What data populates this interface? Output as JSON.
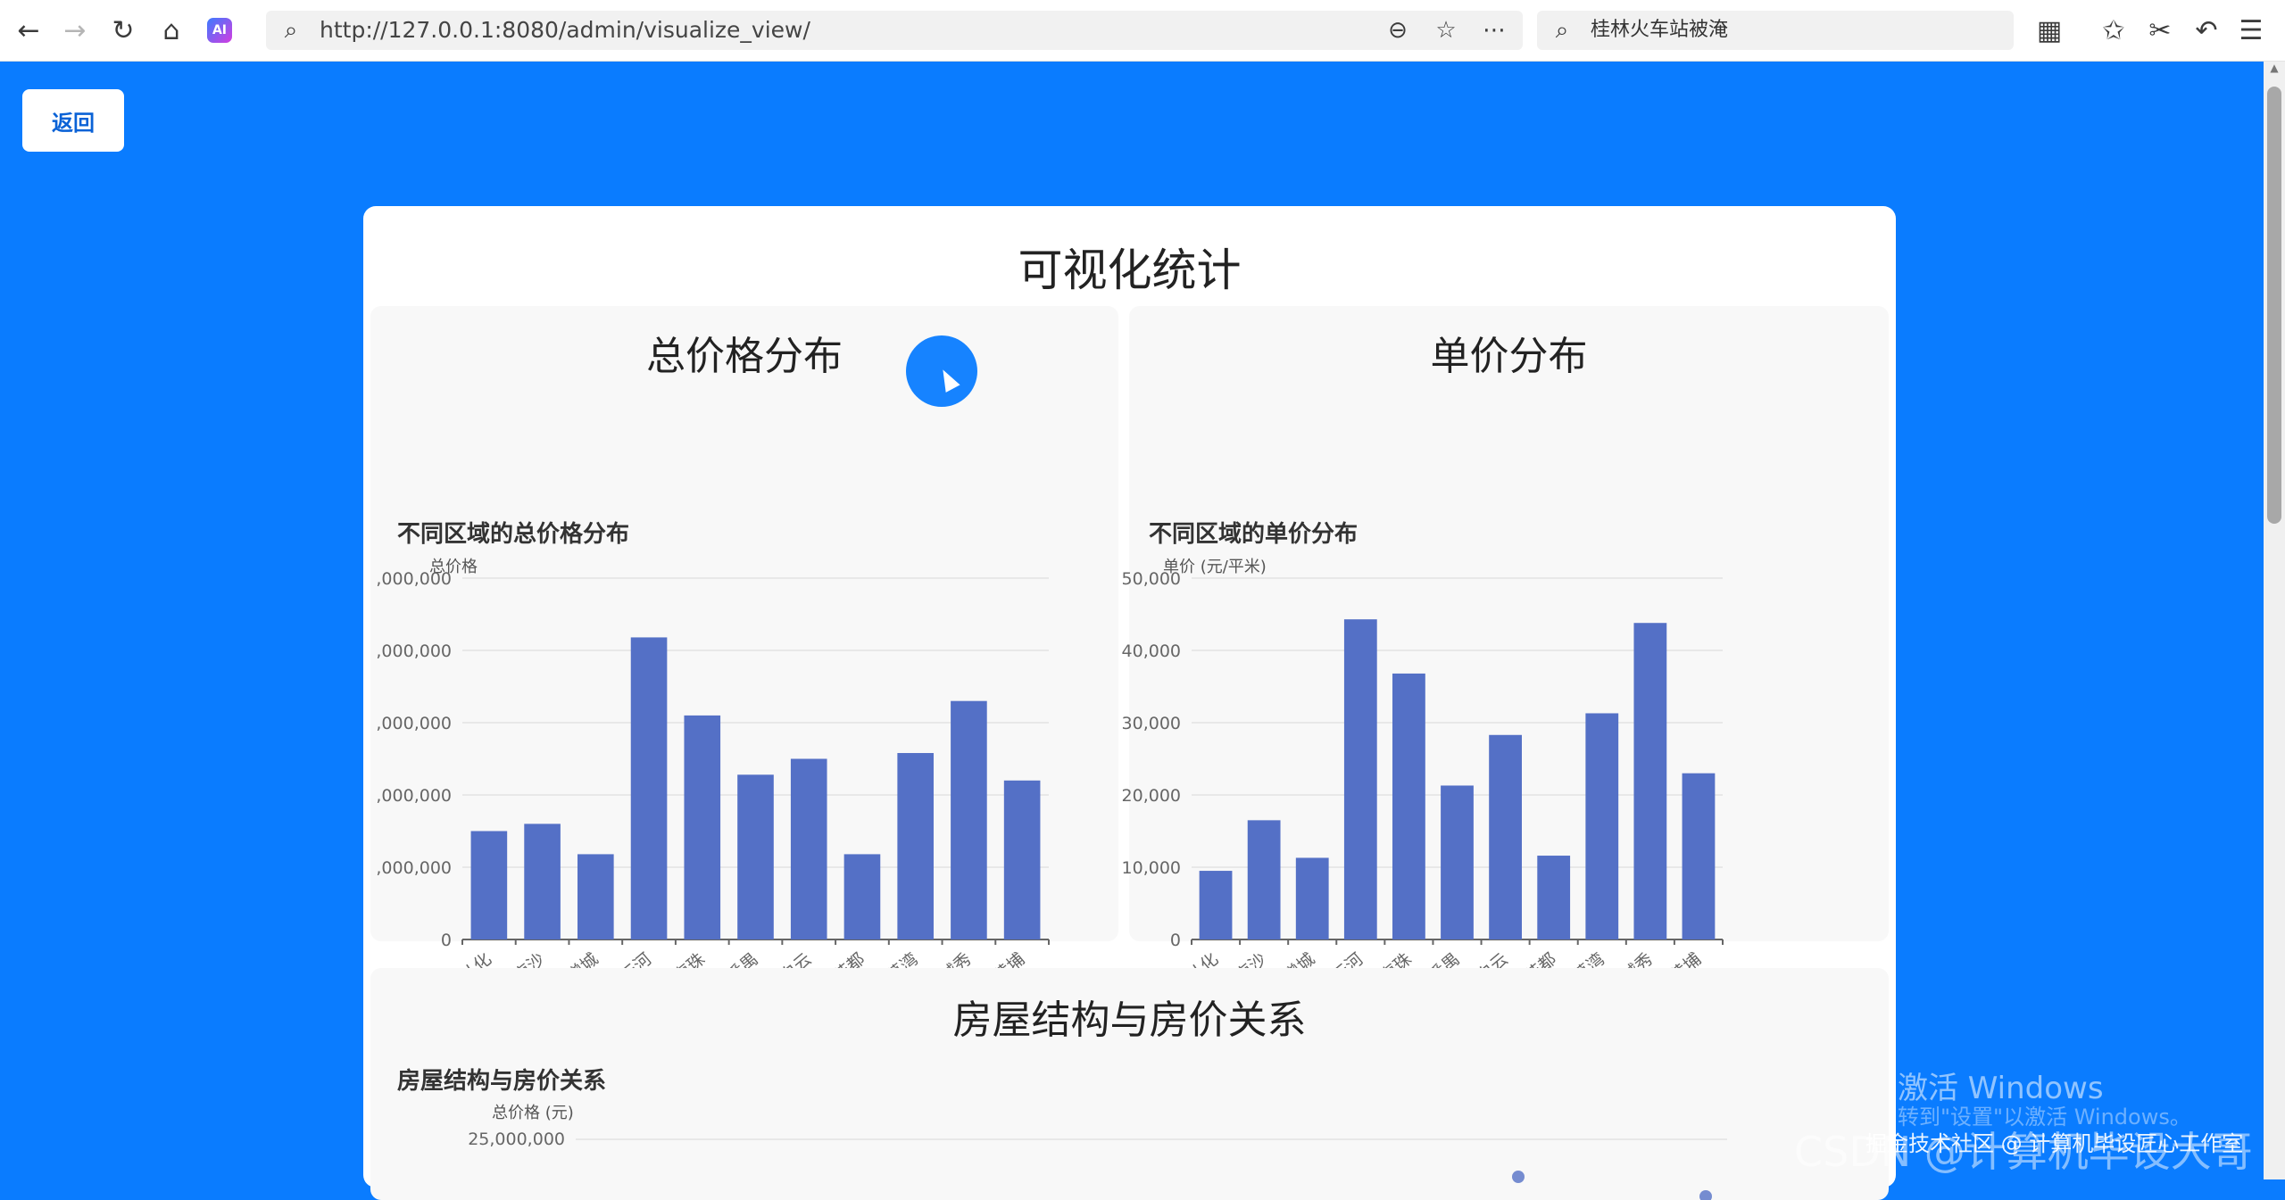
{
  "browser": {
    "url": "http://127.0.0.1:8080/admin/visualize_view/",
    "search_text": "桂林火车站被淹",
    "ai_badge": "AI"
  },
  "page": {
    "back_label": "返回",
    "title": "可视化统计"
  },
  "panels": {
    "total": {
      "heading": "总价格分布"
    },
    "unit": {
      "heading": "单价分布"
    },
    "structure": {
      "heading": "房屋结构与房价关系"
    }
  },
  "chart_data": [
    {
      "type": "bar",
      "title": "不同区域的总价格分布",
      "ylabel": "总价格",
      "categories": [
        "从化",
        "南沙",
        "增城",
        "天河",
        "海珠",
        "番禺",
        "白云",
        "花都",
        "荔湾",
        "越秀",
        "黄埔"
      ],
      "values": [
        1500000,
        1600000,
        1180000,
        4180000,
        3100000,
        2280000,
        2500000,
        1180000,
        2580000,
        3300000,
        2200000
      ],
      "ylim": [
        0,
        5000000
      ],
      "yticks": [
        "0",
        ",000,000",
        ",000,000",
        ",000,000",
        ",000,000",
        ",000,000"
      ]
    },
    {
      "type": "bar",
      "title": "不同区域的单价分布",
      "ylabel": "单价 (元/平米)",
      "categories": [
        "从化",
        "南沙",
        "增城",
        "天河",
        "海珠",
        "番禺",
        "白云",
        "花都",
        "荔湾",
        "越秀",
        "黄埔"
      ],
      "values": [
        9500,
        16500,
        11300,
        44300,
        36800,
        21300,
        28300,
        11600,
        31300,
        43800,
        23000
      ],
      "ylim": [
        0,
        50000
      ],
      "yticks": [
        "0",
        "10,000",
        "20,000",
        "30,000",
        "40,000",
        "50,000"
      ]
    },
    {
      "type": "scatter",
      "title": "房屋结构与房价关系",
      "ylabel": "总价格 (元)",
      "yticks": [
        "25,000,000"
      ]
    }
  ],
  "watermarks": {
    "windows_line1": "激活 Windows",
    "windows_line2": "转到\"设置\"以激活 Windows。",
    "csdn": "CSDN @计算机毕设大哥",
    "juejin": "掘金技术社区 @ 计算机毕设匠心工作室"
  },
  "colors": {
    "background": "#0a7cff",
    "bar": "#5470c6",
    "card": "#ffffff"
  }
}
